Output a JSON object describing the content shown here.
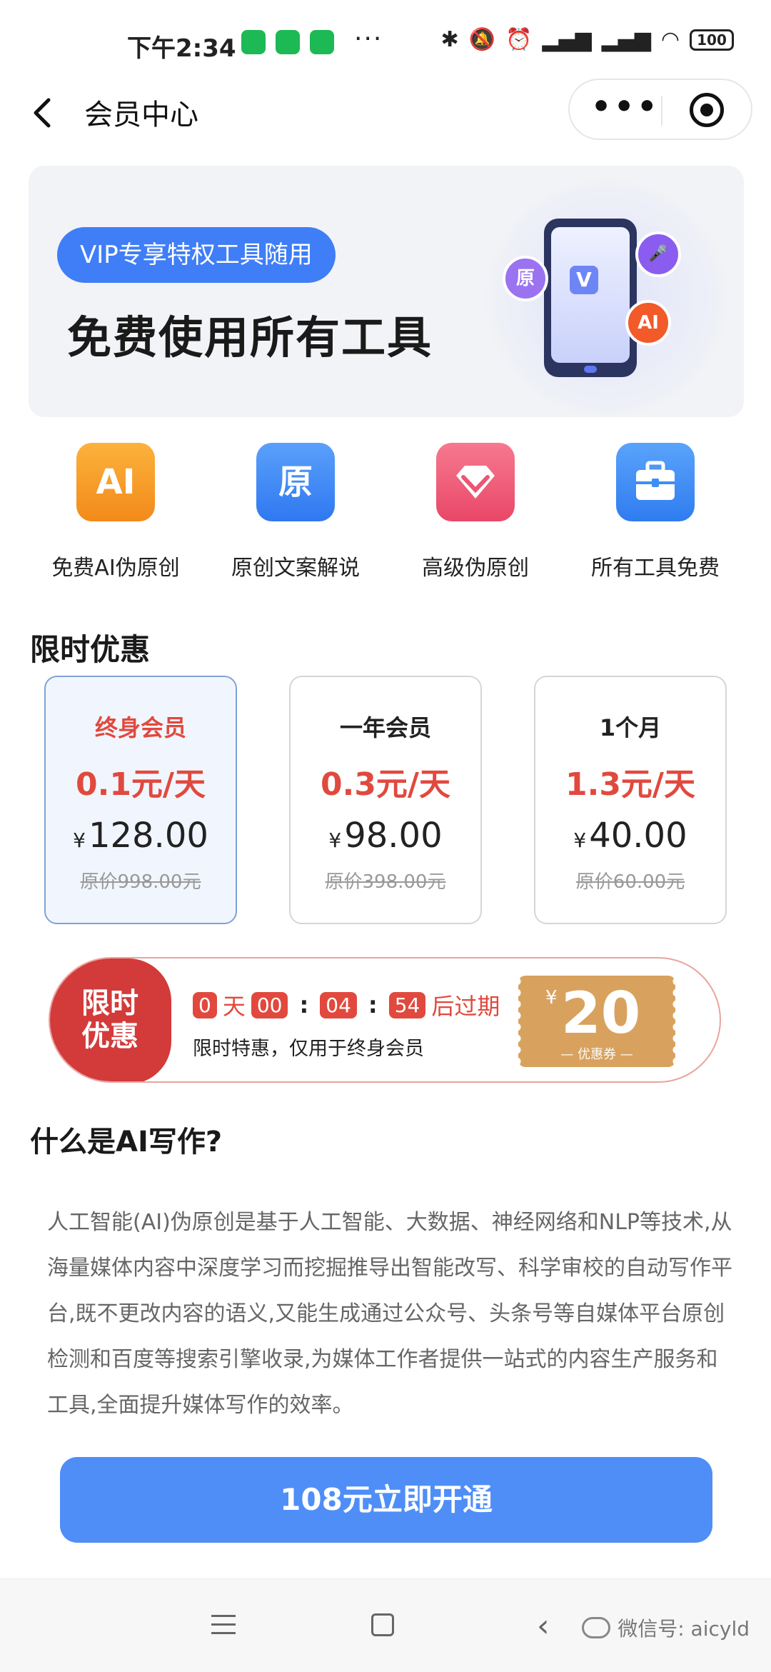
{
  "status_bar": {
    "time": "下午2:34",
    "more": "···",
    "battery": "100",
    "icons": [
      "bluetooth-icon",
      "mute-icon",
      "alarm-icon",
      "signal-hd-icon",
      "signal-hd-icon",
      "wifi-icon",
      "battery-icon"
    ]
  },
  "header": {
    "title": "会员中心",
    "back_icon": "chevron-left-icon",
    "more_icon": "more-dots-icon",
    "close_icon": "target-icon"
  },
  "banner": {
    "pill_text": "VIP专享特权工具随用",
    "title": "免费使用所有工具",
    "bubble_yuan": "原",
    "bubble_ai": "AI",
    "phone_logo": "V"
  },
  "features": [
    {
      "label": "免费AI伪原创",
      "icon_text": "AI",
      "color": "#f59a23"
    },
    {
      "label": "原创文案解说",
      "icon_text": "原",
      "color": "#3f86f5"
    },
    {
      "label": "高级伪原创",
      "icon_text": "",
      "color": "#ef5a78"
    },
    {
      "label": "所有工具免费",
      "icon_text": "",
      "color": "#3e8ef7"
    }
  ],
  "offers": {
    "title": "限时优惠",
    "plans": [
      {
        "name": "终身会员",
        "daily": "0.1元/天",
        "yen": "¥",
        "price": "128.00",
        "original": "原价998.00元",
        "selected": true
      },
      {
        "name": "一年会员",
        "daily": "0.3元/天",
        "yen": "¥",
        "price": "98.00",
        "original": "原价398.00元",
        "selected": false
      },
      {
        "name": "1个月",
        "daily": "1.3元/天",
        "yen": "¥",
        "price": "40.00",
        "original": "原价60.00元",
        "selected": false
      }
    ]
  },
  "countdown": {
    "left_line1": "限时",
    "left_line2": "优惠",
    "days": "0",
    "days_unit": "天",
    "hours": "00",
    "minutes": "04",
    "seconds": "54",
    "colon": ":",
    "suffix": "后过期",
    "note": "限时特惠，仅用于终身会员",
    "coupon_yen": "¥",
    "coupon_amount": "20",
    "coupon_label": "— 优惠券 —"
  },
  "about": {
    "title": "什么是AI写作?",
    "text": "人工智能(AI)伪原创是基于人工智能、大数据、神经网络和NLP等技术,从海量媒体内容中深度学习而挖掘推导出智能改写、科学审校的自动写作平台,既不更改内容的语义,又能生成通过公众号、头条号等自媒体平台原创检测和百度等搜索引擎收录,为媒体工作者提供一站式的内容生产服务和工具,全面提升媒体写作的效率。"
  },
  "cta": {
    "label": "108元立即开通"
  },
  "nav": {
    "watermark": "微信号: aicyld"
  },
  "colors": {
    "accent_blue": "#3f7ef7",
    "price_red": "#e1493e",
    "coupon_gold": "#d8a25e",
    "cta_blue": "#4f8ef7"
  }
}
